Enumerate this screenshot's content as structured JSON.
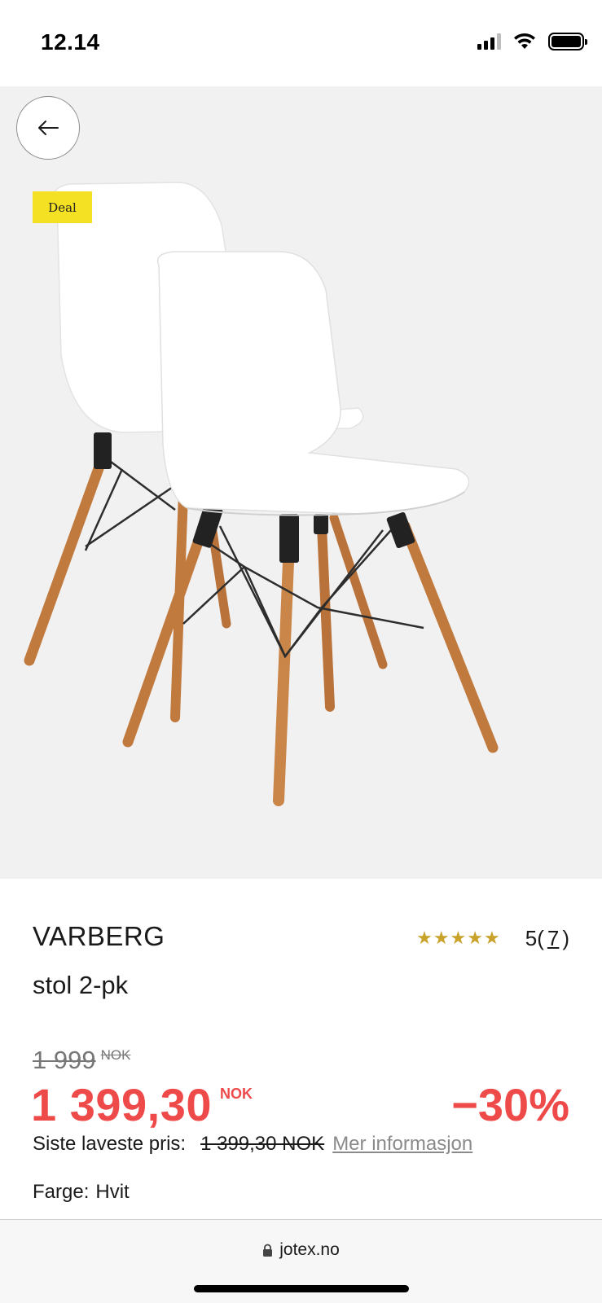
{
  "status_bar": {
    "time": "12.14",
    "icons": [
      "signal-icon",
      "wifi-icon",
      "battery-icon"
    ]
  },
  "hero": {
    "back_icon": "arrow-left-icon",
    "badge": "Deal",
    "image_alt": "product-photo-chairs"
  },
  "product": {
    "brand": "VARBERG",
    "subtitle": "stol 2-pk",
    "rating": {
      "stars": "★★★★★",
      "score": "5",
      "open_paren": "(",
      "count": "7",
      "close_paren": ")",
      "star_color": "#c9a22a"
    },
    "old_price": {
      "value": "1 999",
      "currency": "NOK"
    },
    "price": {
      "value": "1 399,30",
      "currency": "NOK",
      "color": "#ef4a4a"
    },
    "discount": "−30%",
    "lowest_price": {
      "label": "Siste laveste pris:",
      "value": "1 399,30 NOK",
      "link": "Mer informasjon"
    },
    "color": {
      "label": "Farge:",
      "value": "Hvit"
    }
  },
  "browser": {
    "lock_icon": "lock-icon",
    "url": "jotex.no"
  }
}
